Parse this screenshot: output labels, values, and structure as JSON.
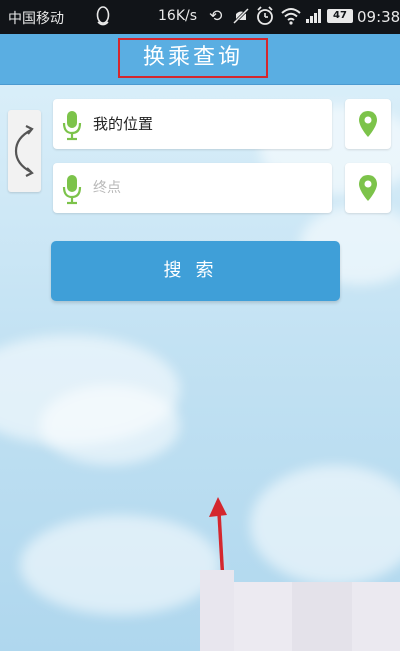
{
  "status_bar": {
    "carrier": "中国移动",
    "speed": "16K/s",
    "sync_glyph": "⟲",
    "battery": "47",
    "time": "09:38",
    "icons": [
      "qq-icon",
      "sync-icon",
      "mute-icon",
      "alarm-icon",
      "wifi-icon",
      "signal-icon",
      "battery-icon"
    ]
  },
  "header": {
    "title": "换乘查询"
  },
  "form": {
    "start_value": "我的位置",
    "end_placeholder": "终点",
    "search_label": "搜索"
  },
  "colors": {
    "header": "#5aaee2",
    "search_button": "#3f9fd8",
    "mic_icon": "#7cc34a",
    "pin_icon": "#7cc34a",
    "annotation": "#d4272e"
  }
}
